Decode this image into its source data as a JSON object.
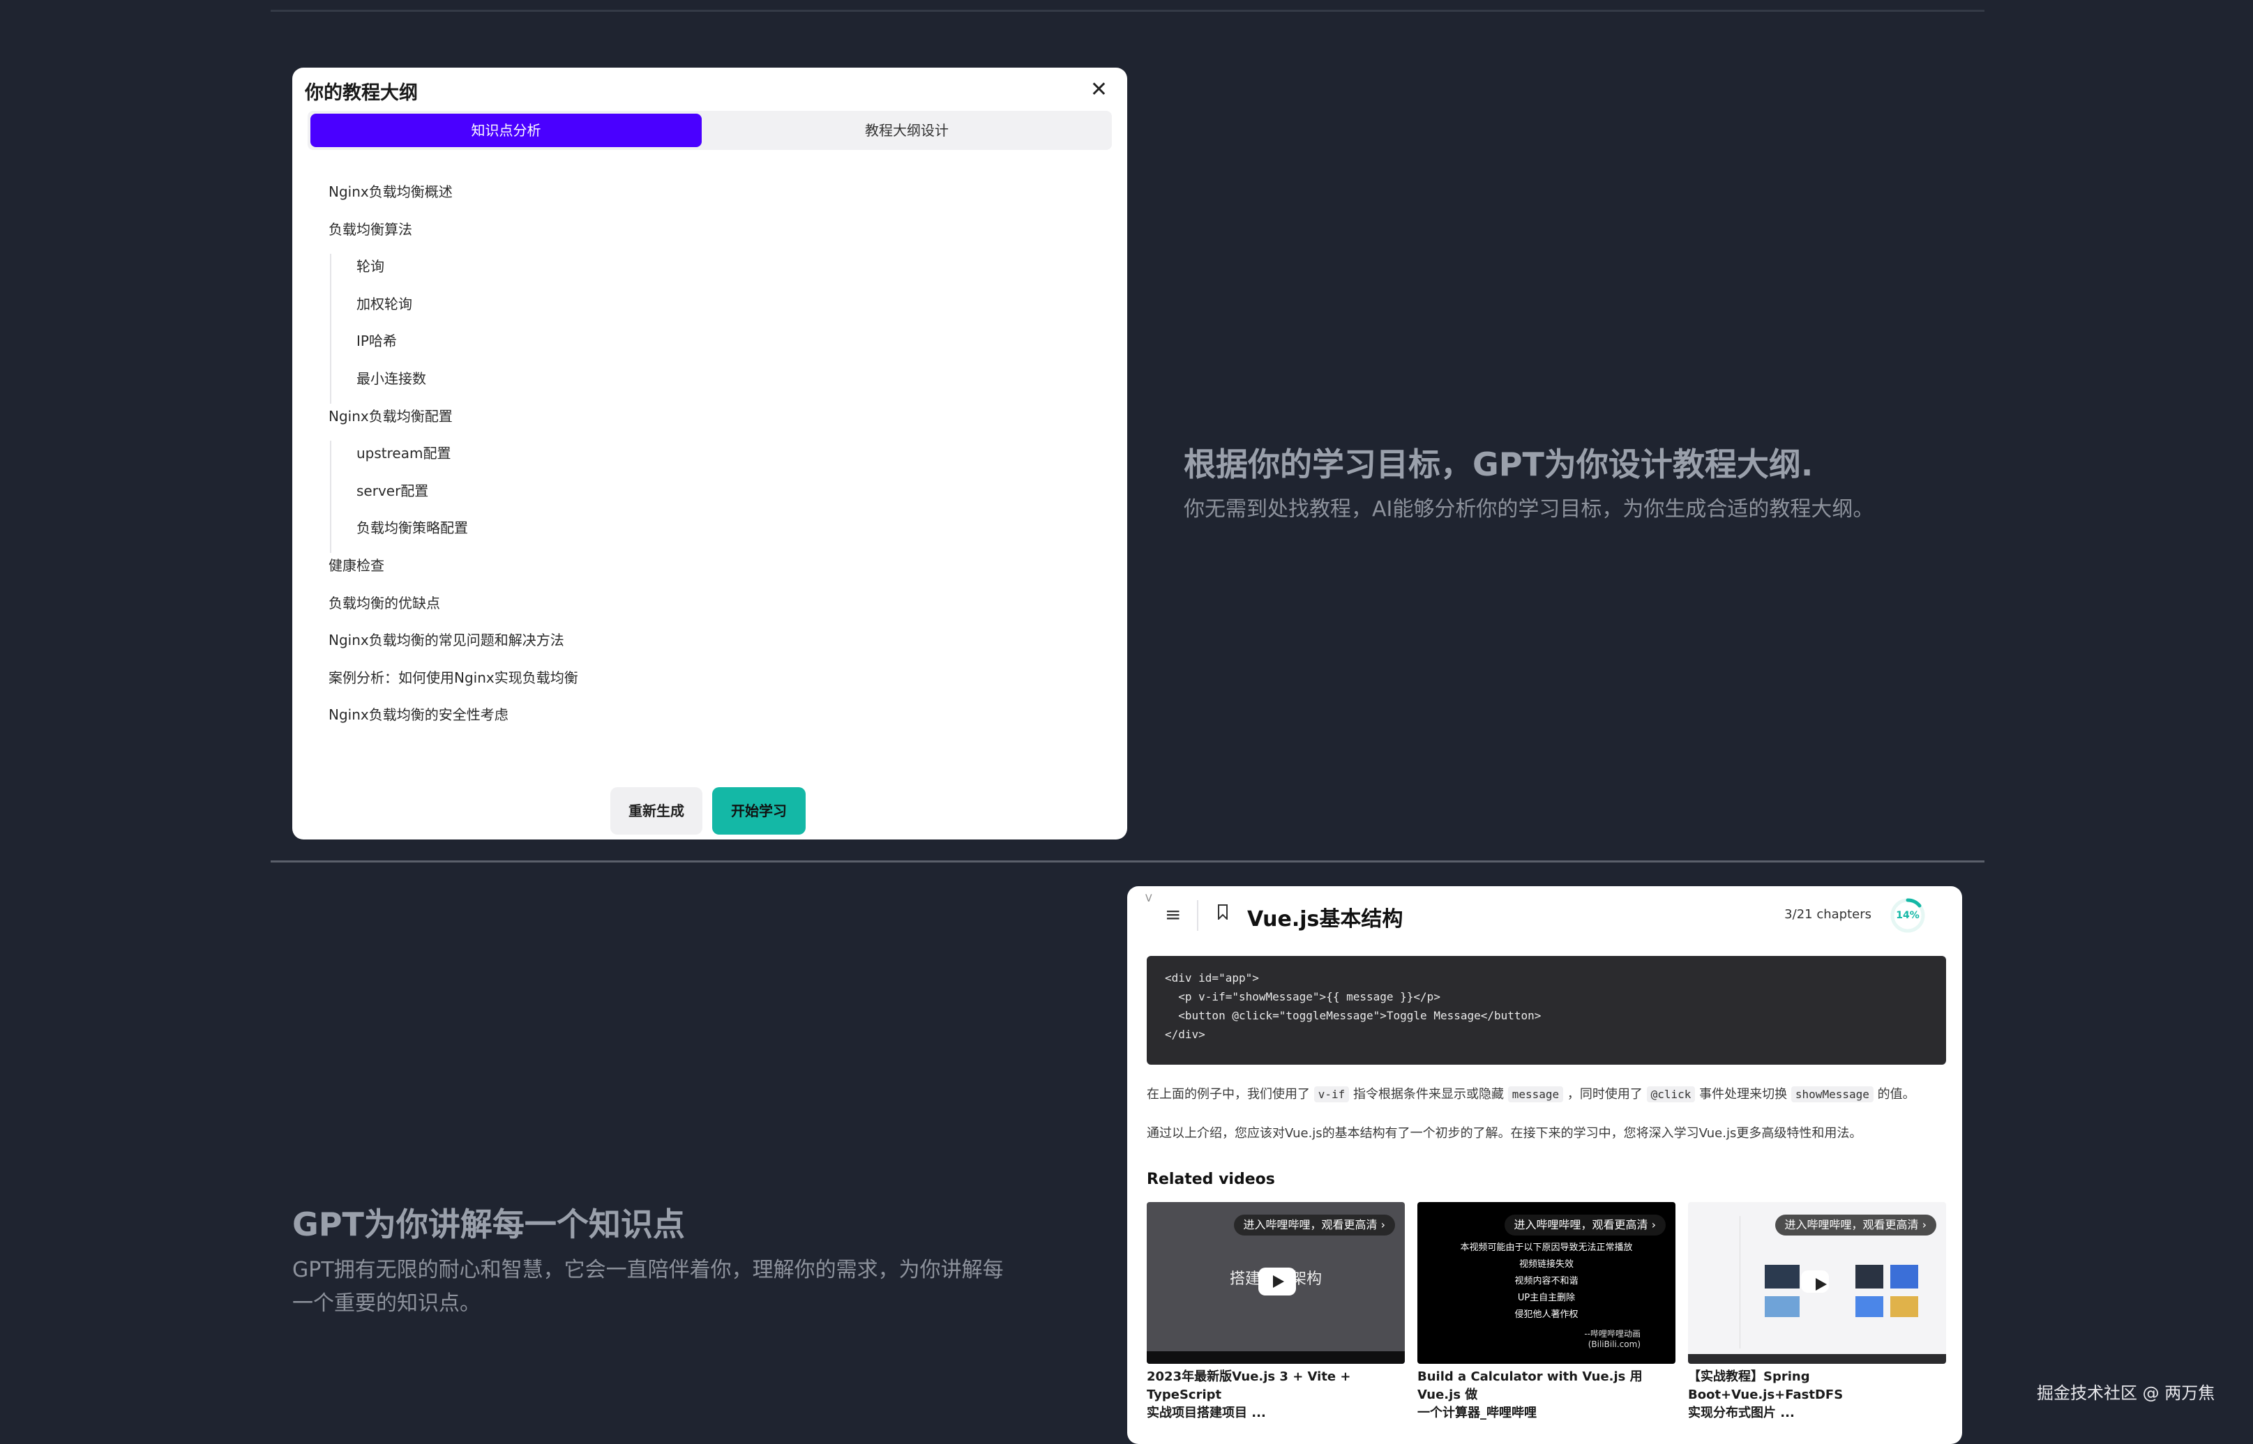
{
  "outline_modal": {
    "title": "你的教程大纲",
    "close_icon": "close-icon",
    "tabs": [
      {
        "label": "知识点分析",
        "active": true
      },
      {
        "label": "教程大纲设计",
        "active": false
      }
    ],
    "items": [
      {
        "label": "Nginx负载均衡概述",
        "level": 0
      },
      {
        "label": "负载均衡算法",
        "level": 0
      },
      {
        "label": "轮询",
        "level": 1
      },
      {
        "label": "加权轮询",
        "level": 1
      },
      {
        "label": "IP哈希",
        "level": 1
      },
      {
        "label": "最小连接数",
        "level": 1
      },
      {
        "label": "Nginx负载均衡配置",
        "level": 0
      },
      {
        "label": "upstream配置",
        "level": 1
      },
      {
        "label": "server配置",
        "level": 1
      },
      {
        "label": "负载均衡策略配置",
        "level": 1
      },
      {
        "label": "健康检查",
        "level": 0
      },
      {
        "label": "负载均衡的优缺点",
        "level": 0
      },
      {
        "label": "Nginx负载均衡的常见问题和解决方法",
        "level": 0
      },
      {
        "label": "案例分析：如何使用Nginx实现负载均衡",
        "level": 0
      },
      {
        "label": "Nginx负载均衡的安全性考虑",
        "level": 0
      }
    ],
    "regenerate_label": "重新生成",
    "start_label": "开始学习",
    "colors": {
      "tab_active": "#4a00ff",
      "start_button": "#14b8a6"
    }
  },
  "feature1": {
    "title": "根据你的学习目标，GPT为你设计教程大纲.",
    "desc": "你无需到处找教程，AI能够分析你的学习目标，为你生成合适的教程大纲。"
  },
  "feature2": {
    "title": "GPT为你讲解每一个知识点",
    "desc_line1": "GPT拥有无限的耐心和智慧，它会一直陪伴着你，理解你的需求，为你讲解每",
    "desc_line2": "一个重要的知识点。"
  },
  "lesson": {
    "corner_mark": "V",
    "menu_icon": "hamburger-menu-icon",
    "bookmark_icon": "bookmark-icon",
    "title": "Vue.js基本结构",
    "chapters": "3/21 chapters",
    "progress_percent": "14%",
    "progress_value": 0.14,
    "code_lines": [
      "<div id=\"app\">",
      "  <p v-if=\"showMessage\">{{ message }}</p>",
      "  <button @click=\"toggleMessage\">Toggle Message</button>",
      "</div>"
    ],
    "para1": {
      "t1": "在上面的例子中，我们使用了",
      "c1": "v-if",
      "t2": "指令根据条件来显示或隐藏",
      "c2": "message",
      "t3": "，同时使用了",
      "c3": "@click",
      "t4": "事件处理来切换",
      "c4": "showMessage",
      "t5": "的值。"
    },
    "para2": "通过以上介绍，您应该对Vue.js的基本结构有了一个初步的了解。在接下来的学习中，您将深入学习Vue.js更多高级特性和用法。",
    "related_title": "Related videos",
    "videos": [
      {
        "pill": "进入哔哩哔哩，观看更高清 ›",
        "thumb_text": "搭建项目架构",
        "caption_line1": "2023年最新版Vue.js 3 + Vite + TypeScript",
        "caption_line2": "实战项目搭建项目 ..."
      },
      {
        "pill": "进入哔哩哔哩，观看更高清 ›",
        "thumb_lines": [
          "本视频可能由于以下原因导致无法正常播放",
          "视频链接失效",
          "视频内容不和谐",
          "UP主自主删除",
          "侵犯他人著作权"
        ],
        "thumb_credit_1": "--哔哩哔哩动画",
        "thumb_credit_2": "(BiliBili.com)",
        "caption_line1": "Build a Calculator with Vue.js 用Vue.js 做",
        "caption_line2": "一个计算器_哔哩哔哩"
      },
      {
        "pill": "进入哔哩哔哩，观看更高清 ›",
        "caption_line1": "【实战教程】Spring Boot+Vue.js+FastDFS",
        "caption_line2": "实现分布式图片 ..."
      }
    ]
  },
  "watermark": "掘金技术社区 @ 两万焦"
}
